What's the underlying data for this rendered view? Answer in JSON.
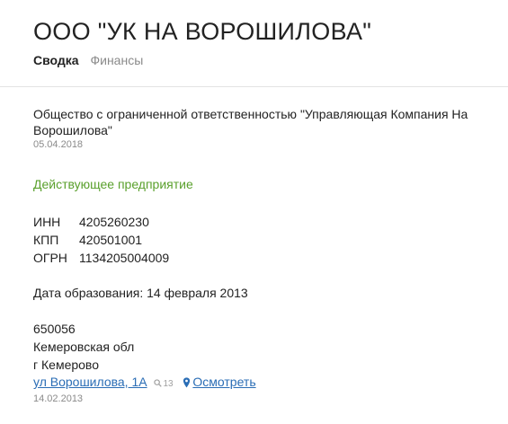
{
  "header": {
    "title": "ООО \"УК НА ВОРОШИЛОВА\"",
    "tabs": [
      {
        "label": "Сводка",
        "active": true
      },
      {
        "label": "Финансы",
        "active": false
      }
    ]
  },
  "summary": {
    "full_name": "Общество с ограниченной ответственностью \"Управляющая Компания На Ворошилова\"",
    "name_date": "05.04.2018",
    "status": "Действующее предприятие",
    "codes": [
      {
        "label": "ИНН",
        "value": "4205260230"
      },
      {
        "label": "КПП",
        "value": "420501001"
      },
      {
        "label": "ОГРН",
        "value": "1134205004009"
      }
    ],
    "registration_date": "Дата образования: 14 февраля 2013",
    "address": {
      "postal_code": "650056",
      "region": "Кемеровская обл",
      "city": "г Кемерово",
      "street": "ул Ворошилова, 1А",
      "search_count": "13",
      "map_link": "Осмотреть",
      "date": "14.02.2013"
    }
  },
  "colors": {
    "status_green": "#5aa02c",
    "link_blue": "#2a6db5",
    "muted_gray": "#8a8a8a"
  }
}
